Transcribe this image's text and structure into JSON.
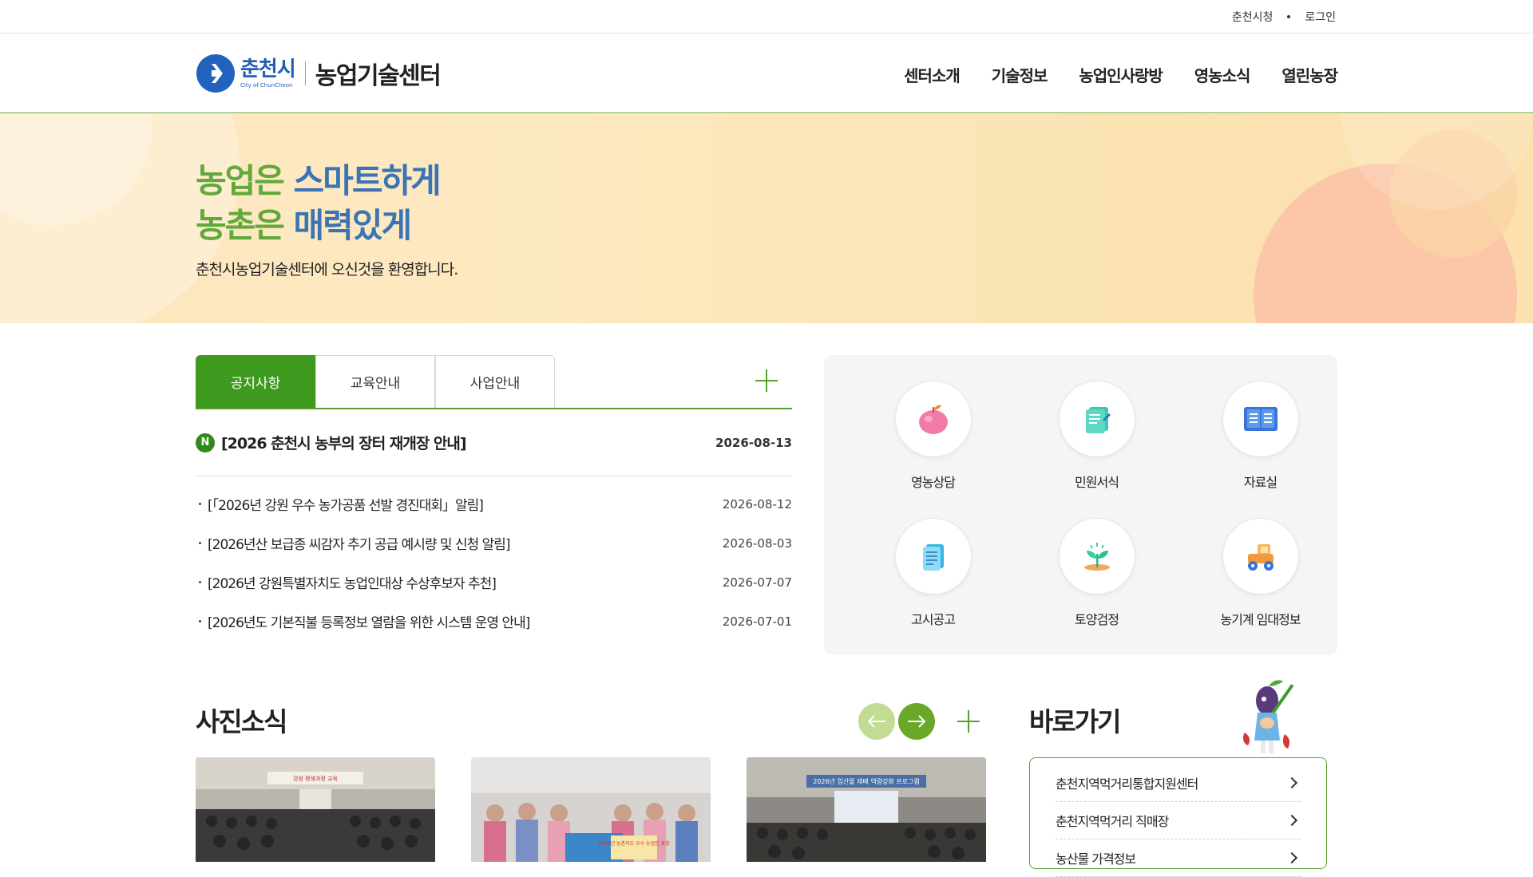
{
  "utility": {
    "city_hall": "춘천시청",
    "login": "로그인"
  },
  "logo": {
    "city_ko": "춘천시",
    "city_en": "City of ChunCheon",
    "org": "농업기술센터"
  },
  "gnb": [
    {
      "label": "센터소개"
    },
    {
      "label": "기술정보"
    },
    {
      "label": "농업인사랑방"
    },
    {
      "label": "영농소식"
    },
    {
      "label": "열린농장"
    }
  ],
  "hero": {
    "line1_a": "농업은",
    "line1_b": "스마트하게",
    "line2_a": "농촌은",
    "line2_b": "매력있게",
    "subtitle": "춘천시농업기술센터에 오신것을 환영합니다."
  },
  "board": {
    "tabs": [
      {
        "label": "공지사항"
      },
      {
        "label": "교육안내"
      },
      {
        "label": "사업안내"
      }
    ],
    "top": {
      "badge": "N",
      "title": "[2026 춘천시 농부의 장터 재개장 안내]",
      "date": "2026-08-13"
    },
    "items": [
      {
        "title": "[「2026년 강원 우수 농가공품 선발 경진대회」알림]",
        "date": "2026-08-12"
      },
      {
        "title": "[2026년산 보급종 씨감자 추기 공급 예시량 및 신청 알림]",
        "date": "2026-08-03"
      },
      {
        "title": "[2026년 강원특별자치도 농업인대상 수상후보자 추천]",
        "date": "2026-07-07"
      },
      {
        "title": "[2026년도 기본직불 등록정보 열람을 위한 시스템 운영 안내]",
        "date": "2026-07-01"
      }
    ]
  },
  "quick": [
    {
      "label": "영농상담",
      "icon": "apple-icon"
    },
    {
      "label": "민원서식",
      "icon": "form-document-icon"
    },
    {
      "label": "자료실",
      "icon": "open-book-icon"
    },
    {
      "label": "고시공고",
      "icon": "notice-document-icon"
    },
    {
      "label": "토양검정",
      "icon": "sprout-icon"
    },
    {
      "label": "농기계 임대정보",
      "icon": "tractor-icon"
    }
  ],
  "photo": {
    "title": "사진소식"
  },
  "shortcuts": {
    "title": "바로가기",
    "items": [
      {
        "label": "춘천지역먹거리통합지원센터"
      },
      {
        "label": "춘천지역먹거리 직매장"
      },
      {
        "label": "농산물 가격정보"
      }
    ]
  },
  "photo_cards": [
    {
      "banner": "강원 평생과정 교육"
    },
    {
      "banner": "2026년 농촌지도 우수 농업인 표창"
    },
    {
      "banner": "2026년 임산물 재배 역량강화 프로그램"
    }
  ],
  "colors": {
    "brand_green": "#3e9a1f",
    "accent_blue": "#3a74b6",
    "hero_bg": "#fde6bf"
  }
}
